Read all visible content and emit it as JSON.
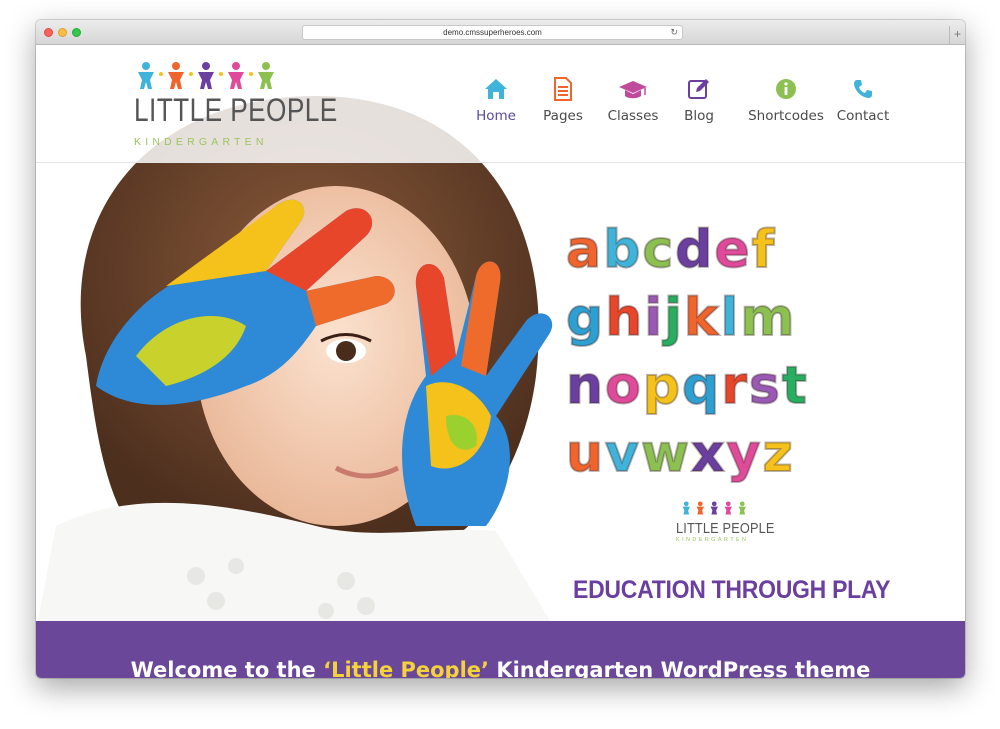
{
  "browser": {
    "url": "demo.cmssuperheroes.com"
  },
  "logo": {
    "title": "LITTLE PEOPLE",
    "subtitle": "KINDERGARTEN"
  },
  "nav": {
    "items": [
      {
        "label": "Home",
        "icon": "home-icon",
        "color": "#3fb3d9"
      },
      {
        "label": "Pages",
        "icon": "document-icon",
        "color": "#f0642e"
      },
      {
        "label": "Classes",
        "icon": "graduation-cap-icon",
        "color": "#c04a9b"
      },
      {
        "label": "Blog",
        "icon": "edit-icon",
        "color": "#6b3fa0"
      },
      {
        "label": "Shortcodes",
        "icon": "info-icon",
        "color": "#8cc152"
      },
      {
        "label": "Contact",
        "icon": "phone-icon",
        "color": "#3fb3d9"
      }
    ]
  },
  "hero": {
    "alphabet_rows": [
      "abcdef",
      "ghijklm",
      "nopqrst",
      "uvwxyz"
    ],
    "mini_logo_title": "LITTLE PEOPLE",
    "mini_logo_subtitle": "KINDERGARTEN",
    "tagline": "EDUCATION THROUGH PLAY"
  },
  "welcome": {
    "prefix": "Welcome to the ",
    "highlight": "‘Little People’",
    "suffix": " Kindergarten WordPress theme"
  },
  "colors": {
    "accent": "#6b3fa0",
    "band": "#6b479a",
    "highlight": "#f4d33a",
    "logo_green": "#9cc45c"
  }
}
